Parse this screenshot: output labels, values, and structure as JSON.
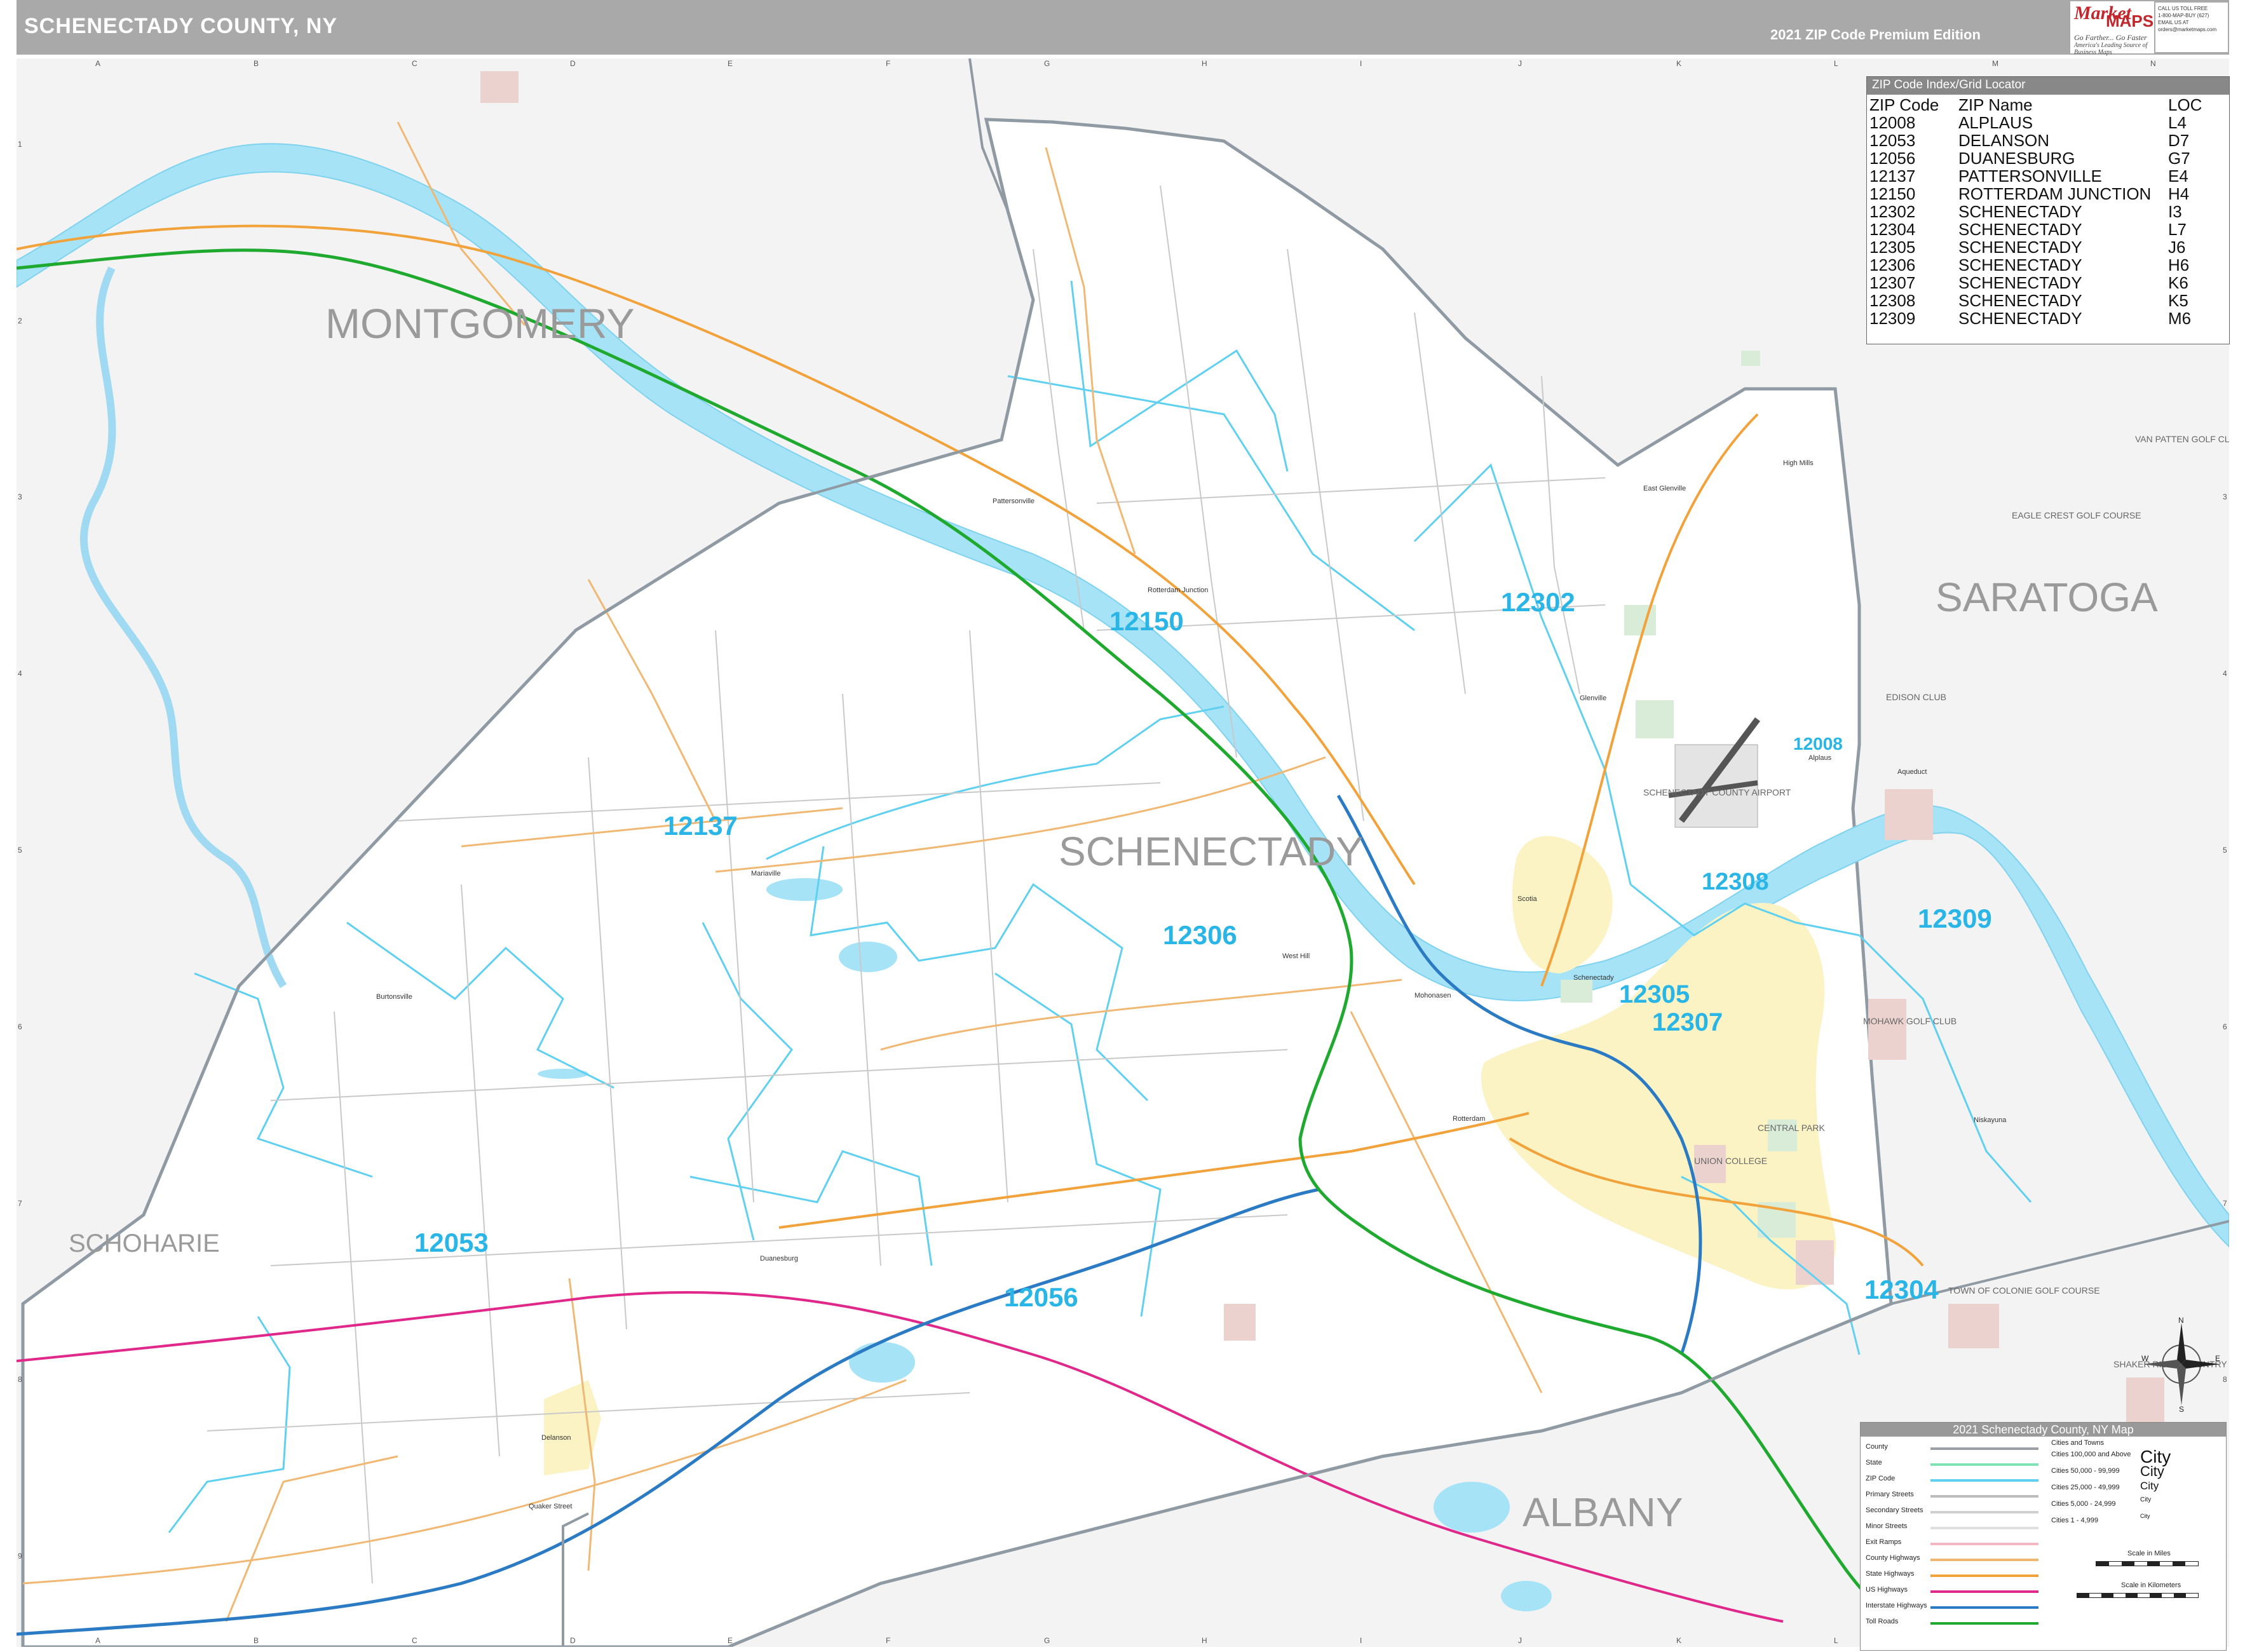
{
  "header": {
    "title": "SCHENECTADY COUNTY, NY",
    "edition": "2021 ZIP Code Premium Edition"
  },
  "logo": {
    "market": "Market",
    "maps": "MAPS",
    "tagline1": "Go Farther... Go Faster",
    "tagline2": "America's Leading Source of Business Maps"
  },
  "contact": {
    "l1": "CALL US TOLL FREE",
    "l2": "1-800-MAP-BUY (627)",
    "l3": "EMAIL US AT",
    "l4": "orders@marketmaps.com"
  },
  "grid": {
    "columns": [
      "A",
      "B",
      "C",
      "D",
      "E",
      "F",
      "G",
      "H",
      "I",
      "J",
      "K",
      "L",
      "M",
      "N"
    ],
    "rows": [
      "1",
      "2",
      "3",
      "4",
      "5",
      "6",
      "7",
      "8",
      "9"
    ]
  },
  "counties": {
    "montgomery": "MONTGOMERY",
    "schenectady": "SCHENECTADY",
    "saratoga": "SARATOGA",
    "schoharie": "SCHOHARIE",
    "albany": "ALBANY"
  },
  "zip_labels": {
    "z12150": "12150",
    "z12302": "12302",
    "z12137": "12137",
    "z12306": "12306",
    "z12308": "12308",
    "z12309": "12309",
    "z12305": "12305",
    "z12307": "12307",
    "z12053": "12053",
    "z12056": "12056",
    "z12304": "12304",
    "z12008": "12008"
  },
  "places": {
    "schenectady_city": "Schenectady",
    "scotia": "Scotia",
    "delanson": "Delanson",
    "mariaville": "Mariaville",
    "rotterdam": "Rotterdam",
    "glenville": "Glenville",
    "niskayuna": "Niskayuna",
    "duanesburg": "Duanesburg",
    "pattersonville": "Pattersonville",
    "rotterdam_jct": "Rotterdam Junction",
    "west_hill": "West Hill",
    "mohonasen": "Mohonasen",
    "alplaus": "Alplaus",
    "quaker_street": "Quaker Street",
    "burtonsville": "Burtonsville",
    "high_mills": "High Mills",
    "east_glenville": "East Glenville",
    "aqueduct": "Aqueduct"
  },
  "golf": {
    "van_patten": "VAN PATTEN GOLF CLUB",
    "eagle_crest": "EAGLE CREST GOLF COURSE",
    "edison": "EDISON CLUB",
    "town_of_colonie": "TOWN OF COLONIE GOLF COURSE",
    "shaker_ridge": "SHAKER RIDGE COUNTRY CLUB",
    "airport": "SCHENECTADY COUNTY AIRPORT",
    "union_college": "UNION COLLEGE",
    "central_park": "CENTRAL PARK",
    "mohawk_golf": "MOHAWK GOLF CLUB"
  },
  "zip_index": {
    "title": "ZIP Code Index/Grid Locator",
    "headers": [
      "ZIP Code",
      "ZIP Name",
      "LOC"
    ],
    "rows": [
      [
        "12008",
        "ALPLAUS",
        "L4"
      ],
      [
        "12053",
        "DELANSON",
        "D7"
      ],
      [
        "12056",
        "DUANESBURG",
        "G7"
      ],
      [
        "12137",
        "PATTERSONVILLE",
        "E4"
      ],
      [
        "12150",
        "ROTTERDAM JUNCTION",
        "H4"
      ],
      [
        "12302",
        "SCHENECTADY",
        "I3"
      ],
      [
        "12304",
        "SCHENECTADY",
        "L7"
      ],
      [
        "12305",
        "SCHENECTADY",
        "J6"
      ],
      [
        "12306",
        "SCHENECTADY",
        "H6"
      ],
      [
        "12307",
        "SCHENECTADY",
        "K6"
      ],
      [
        "12308",
        "SCHENECTADY",
        "K5"
      ],
      [
        "12309",
        "SCHENECTADY",
        "M6"
      ]
    ]
  },
  "legend": {
    "title": "2021 Schenectady County, NY Map",
    "items": [
      {
        "label": "County",
        "color": "#9aa0a6"
      },
      {
        "label": "State",
        "color": "#7fe3b5"
      },
      {
        "label": "ZIP Code",
        "color": "#5fd0f0"
      },
      {
        "label": "Primary Streets",
        "color": "#bdbdbd"
      },
      {
        "label": "Secondary Streets",
        "color": "#cfcfcf"
      },
      {
        "label": "Minor Streets",
        "color": "#e0e0e0"
      },
      {
        "label": "Exit Ramps",
        "color": "#f4b8c4"
      },
      {
        "label": "County Highways",
        "color": "#f0b873"
      },
      {
        "label": "State Highways",
        "color": "#f2a23a"
      },
      {
        "label": "US Highways",
        "color": "#e0288a"
      },
      {
        "label": "Interstate Highways",
        "color": "#2b7bc4"
      },
      {
        "label": "Toll Roads",
        "color": "#1faa2f"
      }
    ],
    "cities_header": "Cities and Towns",
    "cities": [
      {
        "label": "Cities 100,000 and Above",
        "sym": "City"
      },
      {
        "label": "Cities 50,000 - 99,999",
        "sym": "City"
      },
      {
        "label": "Cities 25,000 - 49,999",
        "sym": "City"
      },
      {
        "label": "Cities 5,000 - 24,999",
        "sym": "City"
      },
      {
        "label": "Cities 1 - 4,999",
        "sym": "City"
      }
    ],
    "scale_miles": "Scale in Miles",
    "scale_km": "Scale in Kilometers"
  },
  "compass": {
    "n": "N",
    "s": "S",
    "e": "E",
    "w": "W"
  },
  "colors": {
    "water": "#a6e3f7",
    "county_fill": "#ffffff",
    "outside_fill": "#f2f2f2",
    "zip_line": "#5fd0f0",
    "city_fill": "#fbf3c4",
    "park": "#d9ecd8",
    "golf": "#ecd2cf",
    "toll": "#1faa2f",
    "interstate": "#2b7bc4",
    "us_hwy": "#e0288a",
    "state_hwy": "#f2a23a"
  }
}
